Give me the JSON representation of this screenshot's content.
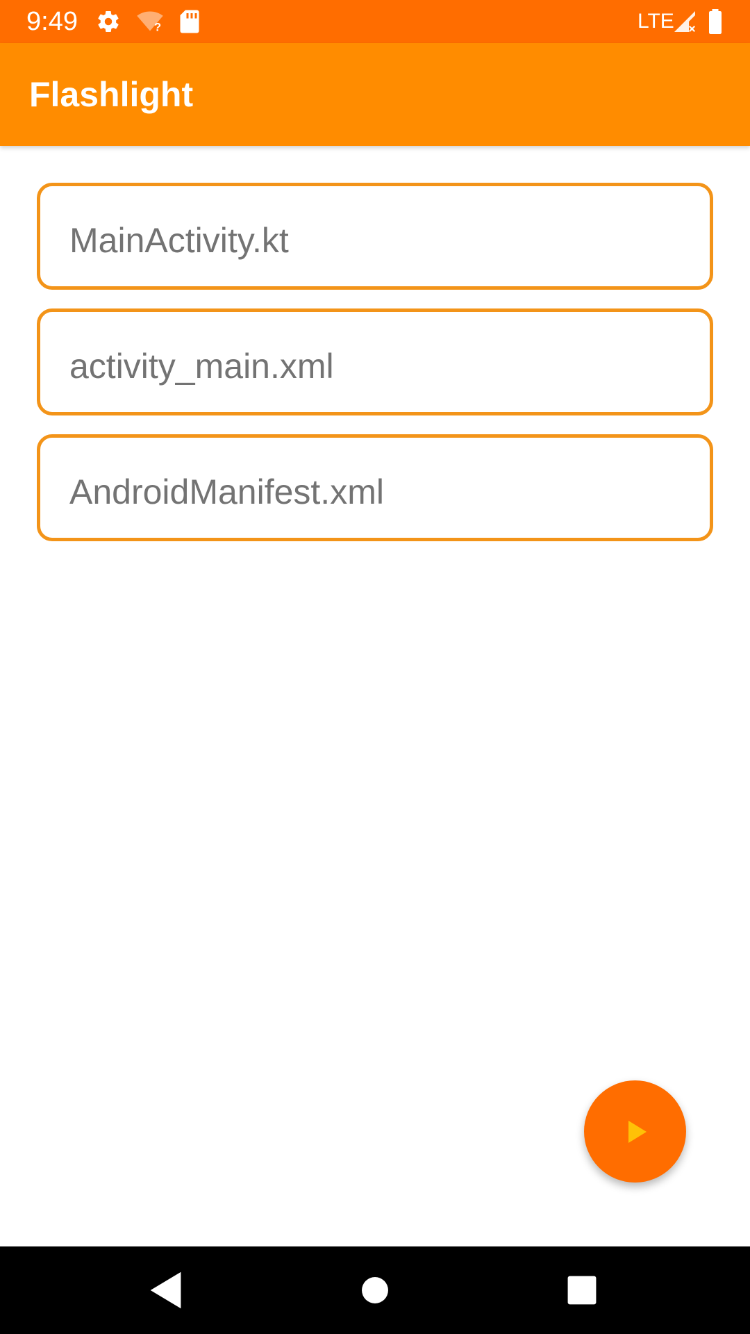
{
  "status_bar": {
    "time": "9:49",
    "network": "LTE",
    "icons": [
      "settings-icon",
      "wifi-unknown-icon",
      "sd-card-icon",
      "signal-icon",
      "battery-icon"
    ],
    "color": "#ff6d00"
  },
  "app_bar": {
    "title": "Flashlight",
    "color": "#ff8c00"
  },
  "files": [
    {
      "name": "MainActivity.kt"
    },
    {
      "name": "activity_main.xml"
    },
    {
      "name": "AndroidManifest.xml"
    }
  ],
  "file_border_color": "#f39419",
  "fab": {
    "icon": "play-icon",
    "color": "#ff6d00",
    "icon_color": "#ffc107"
  },
  "nav_bar": {
    "buttons": [
      "back-icon",
      "home-icon",
      "recents-icon"
    ]
  }
}
